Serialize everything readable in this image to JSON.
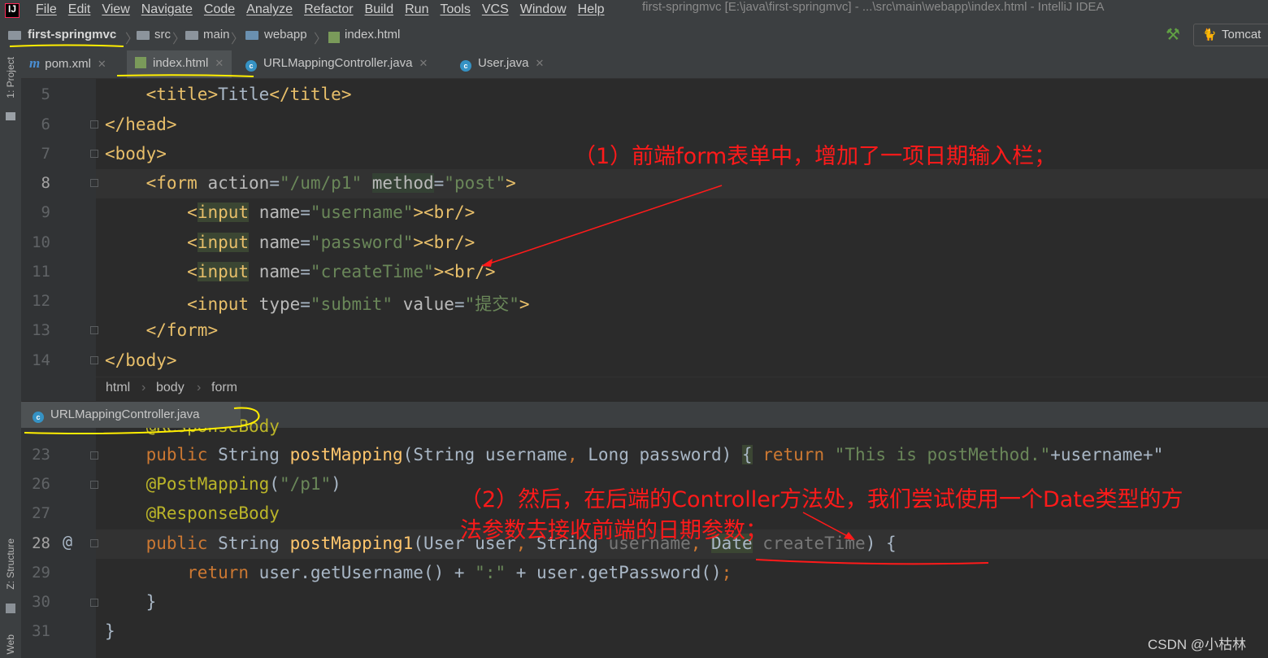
{
  "menu": {
    "logo": "IJ",
    "items": [
      "File",
      "Edit",
      "View",
      "Navigate",
      "Code",
      "Analyze",
      "Refactor",
      "Build",
      "Run",
      "Tools",
      "VCS",
      "Window",
      "Help"
    ],
    "window_title": "first-springmvc [E:\\java\\first-springmvc] - ...\\src\\main\\webapp\\index.html - IntelliJ IDEA"
  },
  "navbar": {
    "project": "first-springmvc",
    "crumbs": [
      "src",
      "main",
      "webapp",
      "index.html"
    ],
    "run_config": "Tomcat"
  },
  "side": {
    "project_label": "1: Project",
    "structure_label": "Z: Structure",
    "web_label": "Web"
  },
  "tabs": [
    {
      "label": "pom.xml"
    },
    {
      "label": "index.html"
    },
    {
      "label": "URLMappingController.java"
    },
    {
      "label": "User.java"
    }
  ],
  "html_editor": {
    "line_numbers": [
      "5",
      "6",
      "7",
      "8",
      "9",
      "10",
      "11",
      "12",
      "13",
      "14"
    ],
    "lines": [
      "    <title>Title</title>",
      "</head>",
      "<body>",
      "    <form action=\"/um/p1\" method=\"post\">",
      "        <input name=\"username\"><br/>",
      "        <input name=\"password\"><br/>",
      "        <input name=\"createTime\"><br/>",
      "        <input type=\"submit\" value=\"提交\">",
      "    </form>",
      "</body>"
    ],
    "breadcrumbs": [
      "html",
      "body",
      "form"
    ]
  },
  "java_editor": {
    "tab_label": "URLMappingController.java",
    "line_numbers": [
      "23",
      "26",
      "27",
      "28",
      "29",
      "30",
      "31"
    ],
    "partial_line": "    @ResponseBody",
    "lines": [
      "    public String postMapping(String username, Long password) { return \"This is postMethod.\"+username+\"",
      "    @PostMapping(\"/p1\")",
      "    @ResponseBody",
      "    public String postMapping1(User user, String username, Date createTime) {",
      "        return user.getUsername() + \":\" + user.getPassword();",
      "    }",
      "}"
    ],
    "gutter_marker": "@"
  },
  "annotations": {
    "note1": "（1）前端form表单中，增加了一项日期输入栏；",
    "note2_line1": "（2）然后，在后端的Controller方法处，我们尝试使用一个Date类型的方",
    "note2_line2": "法参数去接收前端的日期参数；",
    "color": "#ff1a1a",
    "highlight_color": "#ffee00"
  },
  "watermark": "CSDN @小枯林"
}
